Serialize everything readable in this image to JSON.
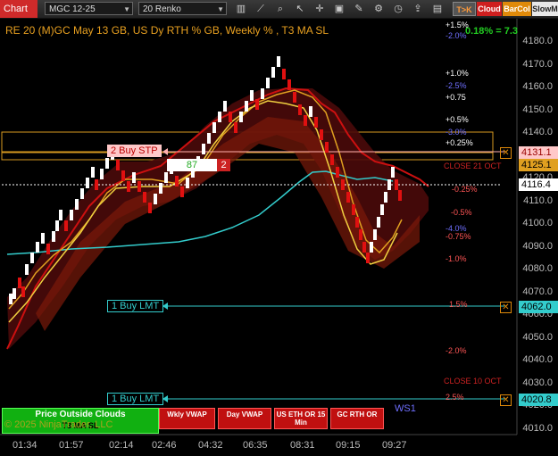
{
  "window": {
    "title": "Chart"
  },
  "toolbar": {
    "instrument": "MGC 12-25",
    "bar_type": "20 Renko",
    "buttons": {
      "tok": "T>K",
      "cloud": "Cloud",
      "barcol": "BarCol",
      "slowm": "SlowM"
    }
  },
  "chart": {
    "title": "RE 20  (M)GC May 13 GB, US Dy RTH % GB, Weekly % , T3 MA SL",
    "stat": "0.18% = 7.3",
    "price_axis": [
      "4180.0",
      "4170.0",
      "4160.0",
      "4150.0",
      "4140.0",
      "4130.0",
      "4120.0",
      "4110.0",
      "4100.0",
      "4090.0",
      "4080.0",
      "4070.0",
      "4060.0",
      "4050.0",
      "4040.0",
      "4030.0",
      "4020.0",
      "4010.0"
    ],
    "time_axis": [
      "01:34",
      "01:57",
      "02:14",
      "02:46",
      "04:32",
      "06:35",
      "08:31",
      "09:15",
      "09:27"
    ],
    "levels": [
      {
        "text": "+1.5%",
        "color": "#ffffff"
      },
      {
        "text": "-2.0%",
        "color": "#6f6fff"
      },
      {
        "text": "+1.0%",
        "color": "#ffffff"
      },
      {
        "text": "-2.5%",
        "color": "#6f6fff"
      },
      {
        "text": "+0.75",
        "color": "#ffffff"
      },
      {
        "text": "+0.5%",
        "color": "#ffffff"
      },
      {
        "text": "-3.0%",
        "color": "#6f6fff"
      },
      {
        "text": "+0.25%",
        "color": "#ffffff"
      },
      {
        "text": "CLOSE 21 OCT",
        "color": "#cc2222"
      },
      {
        "text": "-0.25%",
        "color": "#ff5555"
      },
      {
        "text": "-0.5%",
        "color": "#ff5555"
      },
      {
        "text": "-4.0%",
        "color": "#6f6fff"
      },
      {
        "text": "-0.75%",
        "color": "#ff5555"
      },
      {
        "text": "-1.0%",
        "color": "#ff5555"
      },
      {
        "text": "1.5%",
        "color": "#ff5555"
      },
      {
        "text": "-2.0%",
        "color": "#ff5555"
      },
      {
        "text": "CLOSE 10 OCT",
        "color": "#cc2222"
      },
      {
        "text": "2.5%",
        "color": "#ff5555"
      }
    ],
    "orders": {
      "stop_label": "2 Buy STP",
      "limit1_label": "1 Buy LMT",
      "limit2_label": "1 Buy LMT",
      "position_qty": "87",
      "position_count": "2"
    },
    "price_tags": {
      "stop": "4131.1",
      "last_close": "4125.1",
      "current": "4116.4",
      "limit1": "4062.0",
      "limit2": "4020.8"
    },
    "marker_ws1": "WS1",
    "footer_buttons": {
      "price_outside": "Price Outside Clouds",
      "t3": "T3 MA SL",
      "wkly_vwap": "Wkly VWAP",
      "day_vwap": "Day VWAP",
      "us_eth": "US ETH OR 15 Min",
      "gc_rth": "GC RTH OR"
    },
    "copyright": "© 2025 NinjaTrader, LLC",
    "colors": {
      "accent": "#cf2a2a",
      "cyan": "#33cccc",
      "gold": "#e0a020",
      "green": "#22cc22"
    }
  }
}
